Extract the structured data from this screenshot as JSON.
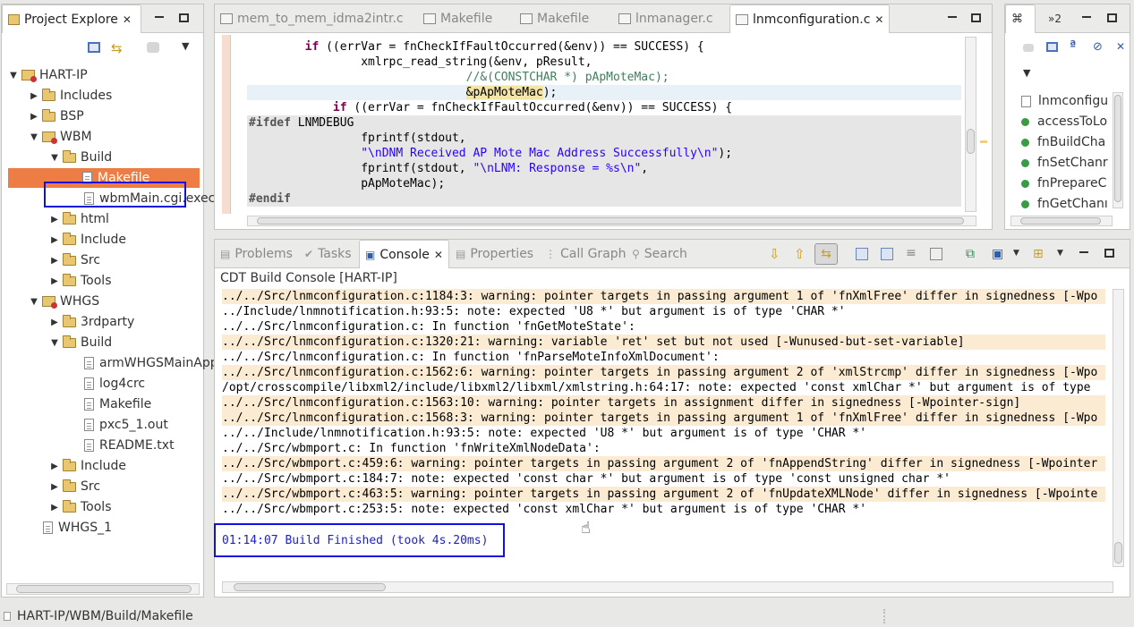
{
  "project_explorer": {
    "title": "Project Explore",
    "tree": [
      {
        "label": "HART-IP",
        "depth": 0,
        "arrow": "▼",
        "icon": "project"
      },
      {
        "label": "Includes",
        "depth": 1,
        "arrow": "▶",
        "icon": "folder"
      },
      {
        "label": "BSP",
        "depth": 1,
        "arrow": "▶",
        "icon": "folder"
      },
      {
        "label": "WBM",
        "depth": 1,
        "arrow": "▼",
        "icon": "project"
      },
      {
        "label": "Build",
        "depth": 2,
        "arrow": "▼",
        "icon": "folder"
      },
      {
        "label": "Makefile",
        "depth": 3,
        "arrow": "",
        "icon": "file",
        "selected": true
      },
      {
        "label": "wbmMain.cgi.exec",
        "depth": 3,
        "arrow": "",
        "icon": "file"
      },
      {
        "label": "html",
        "depth": 2,
        "arrow": "▶",
        "icon": "folder"
      },
      {
        "label": "Include",
        "depth": 2,
        "arrow": "▶",
        "icon": "folder"
      },
      {
        "label": "Src",
        "depth": 2,
        "arrow": "▶",
        "icon": "folder"
      },
      {
        "label": "Tools",
        "depth": 2,
        "arrow": "▶",
        "icon": "folder"
      },
      {
        "label": "WHGS",
        "depth": 1,
        "arrow": "▼",
        "icon": "project"
      },
      {
        "label": "3rdparty",
        "depth": 2,
        "arrow": "▶",
        "icon": "folder"
      },
      {
        "label": "Build",
        "depth": 2,
        "arrow": "▼",
        "icon": "folder"
      },
      {
        "label": "armWHGSMainApp",
        "depth": 3,
        "arrow": "",
        "icon": "file"
      },
      {
        "label": "log4crc",
        "depth": 3,
        "arrow": "",
        "icon": "file"
      },
      {
        "label": "Makefile",
        "depth": 3,
        "arrow": "",
        "icon": "file"
      },
      {
        "label": "pxc5_1.out",
        "depth": 3,
        "arrow": "",
        "icon": "file"
      },
      {
        "label": "README.txt",
        "depth": 3,
        "arrow": "",
        "icon": "file"
      },
      {
        "label": "Include",
        "depth": 2,
        "arrow": "▶",
        "icon": "folder"
      },
      {
        "label": "Src",
        "depth": 2,
        "arrow": "▶",
        "icon": "folder"
      },
      {
        "label": "Tools",
        "depth": 2,
        "arrow": "▶",
        "icon": "folder"
      },
      {
        "label": "WHGS_1",
        "depth": 1,
        "arrow": "",
        "icon": "file"
      }
    ]
  },
  "editor": {
    "tabs": [
      {
        "label": "mem_to_mem_idma2intr.c",
        "active": false
      },
      {
        "label": "Makefile",
        "active": false
      },
      {
        "label": "Makefile",
        "active": false
      },
      {
        "label": "lnmanager.c",
        "active": false
      },
      {
        "label": "lnmconfiguration.c",
        "active": true
      }
    ]
  },
  "outline": {
    "tab_label": "»2",
    "items": [
      "lnmconfigu",
      "accessToLo",
      "fnBuildCha",
      "fnSetChanr",
      "fnPrepareC",
      "fnGetChanı"
    ]
  },
  "bottom_panel": {
    "tabs": [
      "Problems",
      "Tasks",
      "Console",
      "Properties",
      "Call Graph",
      "Search"
    ],
    "active_tab": "Console",
    "console_title": "CDT Build Console [HART-IP]",
    "lines": [
      {
        "text": "../../Src/lnmconfiguration.c:1184:3: warning: pointer targets in passing argument 1 of 'fnXmlFree' differ in signedness [-Wpo",
        "warn": true
      },
      {
        "text": "../Include/lnmnotification.h:93:5: note: expected 'U8 *' but argument is of type 'CHAR *'",
        "warn": false
      },
      {
        "text": "../../Src/lnmconfiguration.c: In function 'fnGetMoteState':",
        "warn": false
      },
      {
        "text": "../../Src/lnmconfiguration.c:1320:21: warning: variable 'ret' set but not used [-Wunused-but-set-variable]",
        "warn": true
      },
      {
        "text": "../../Src/lnmconfiguration.c: In function 'fnParseMoteInfoXmlDocument':",
        "warn": false
      },
      {
        "text": "../../Src/lnmconfiguration.c:1562:6: warning: pointer targets in passing argument 2 of 'xmlStrcmp' differ in signedness [-Wpo",
        "warn": true
      },
      {
        "text": "/opt/crosscompile/libxml2/include/libxml2/libxml/xmlstring.h:64:17: note: expected 'const xmlChar *' but argument is of type",
        "warn": false
      },
      {
        "text": "../../Src/lnmconfiguration.c:1563:10: warning: pointer targets in assignment differ in signedness [-Wpointer-sign]",
        "warn": true
      },
      {
        "text": "../../Src/lnmconfiguration.c:1568:3: warning: pointer targets in passing argument 1 of 'fnXmlFree' differ in signedness [-Wpo",
        "warn": true
      },
      {
        "text": "../../Include/lnmnotification.h:93:5: note: expected 'U8 *' but argument is of type 'CHAR *'",
        "warn": false
      },
      {
        "text": "../../Src/wbmport.c: In function 'fnWriteXmlNodeData':",
        "warn": false
      },
      {
        "text": "../../Src/wbmport.c:459:6: warning: pointer targets in passing argument 2 of 'fnAppendString' differ in signedness [-Wpointer",
        "warn": true
      },
      {
        "text": "../../Src/wbmport.c:184:7: note: expected 'const char *' but argument is of type 'const unsigned char *'",
        "warn": false
      },
      {
        "text": "../../Src/wbmport.c:463:5: warning: pointer targets in passing argument 2 of 'fnUpdateXMLNode' differ in signedness [-Wpointe",
        "warn": true
      },
      {
        "text": "../../Src/wbmport.c:253:5: note: expected 'const xmlChar *' but argument is of type 'CHAR *'",
        "warn": false
      }
    ],
    "build_finished": "01:14:07 Build Finished (took 4s.20ms)"
  },
  "status_bar": {
    "path": "HART-IP/WBM/Build/Makefile"
  },
  "colors": {
    "selection": "#ee7d45",
    "highlight_box": "#1111dd",
    "warning_bg": "#fcebd3",
    "finished_text": "#2020c8"
  }
}
